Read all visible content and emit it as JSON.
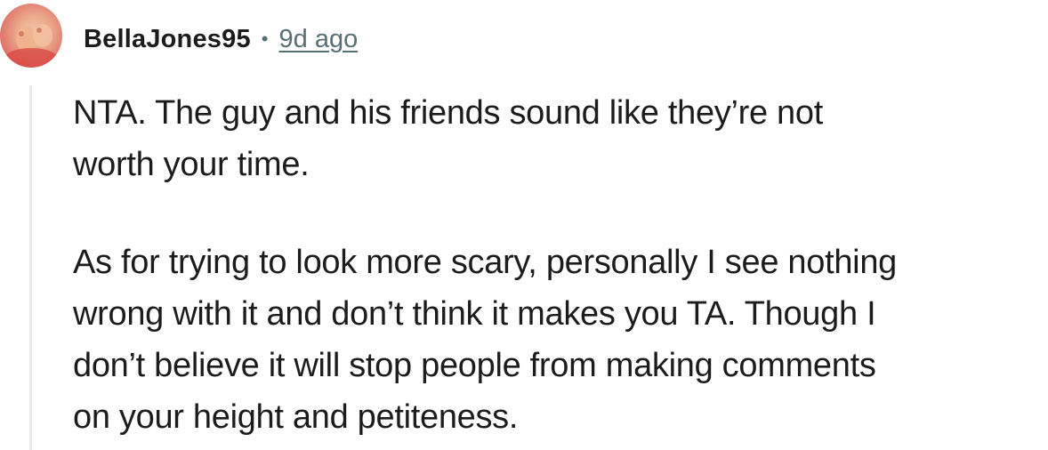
{
  "comment": {
    "author": "BellaJones95",
    "separator": "•",
    "timestamp": "9d ago",
    "avatar_icon": "user-avatar-icon",
    "paragraphs": [
      "NTA. The guy and his friends sound like they’re not\nworth your time.",
      "As for trying to look more scary, personally I see nothing\nwrong with it and don’t think it makes you TA. Though I\ndon’t believe it will stop people from making comments\non your height and petiteness."
    ]
  },
  "colors": {
    "text": "#1c1c1c",
    "meta": "#576f76",
    "thread_line": "#e5ebee"
  }
}
